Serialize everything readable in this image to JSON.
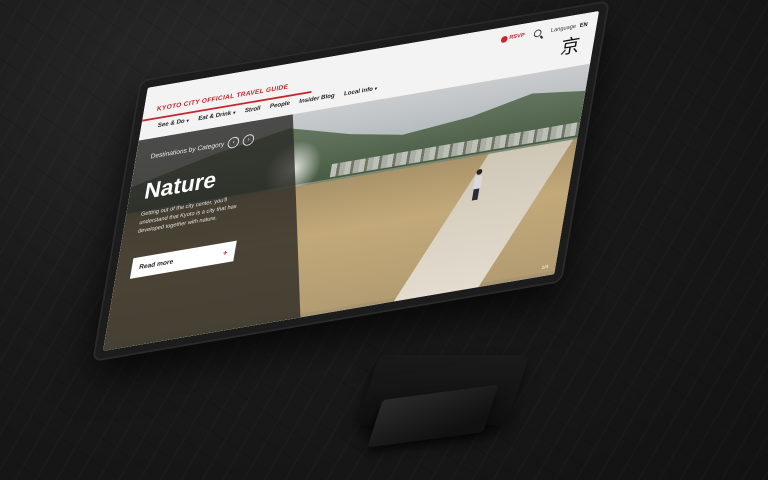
{
  "header": {
    "brand": "KYOTO CITY OFFICIAL TRAVEL GUIDE",
    "rsvp": "RSVP",
    "language_label": "Language",
    "language_value": "EN",
    "logo_glyph": "京"
  },
  "nav": {
    "items": [
      {
        "label": "See & Do",
        "chev": "▾"
      },
      {
        "label": "Eat & Drink",
        "chev": "▾"
      },
      {
        "label": "Stroll",
        "chev": ""
      },
      {
        "label": "People",
        "chev": ""
      },
      {
        "label": "Insider Blog",
        "chev": ""
      },
      {
        "label": "Local info",
        "chev": "▾"
      }
    ]
  },
  "hero": {
    "category_label": "Destinations by Category",
    "prev": "‹",
    "next": "›",
    "title": "Nature",
    "description": "Getting out of the city center, you'll understand that Kyoto is a city that has developed together with nature.",
    "cta": "Read more",
    "cta_icon": "+",
    "page_indicator": "1/4"
  },
  "colors": {
    "accent": "#c9252c"
  }
}
